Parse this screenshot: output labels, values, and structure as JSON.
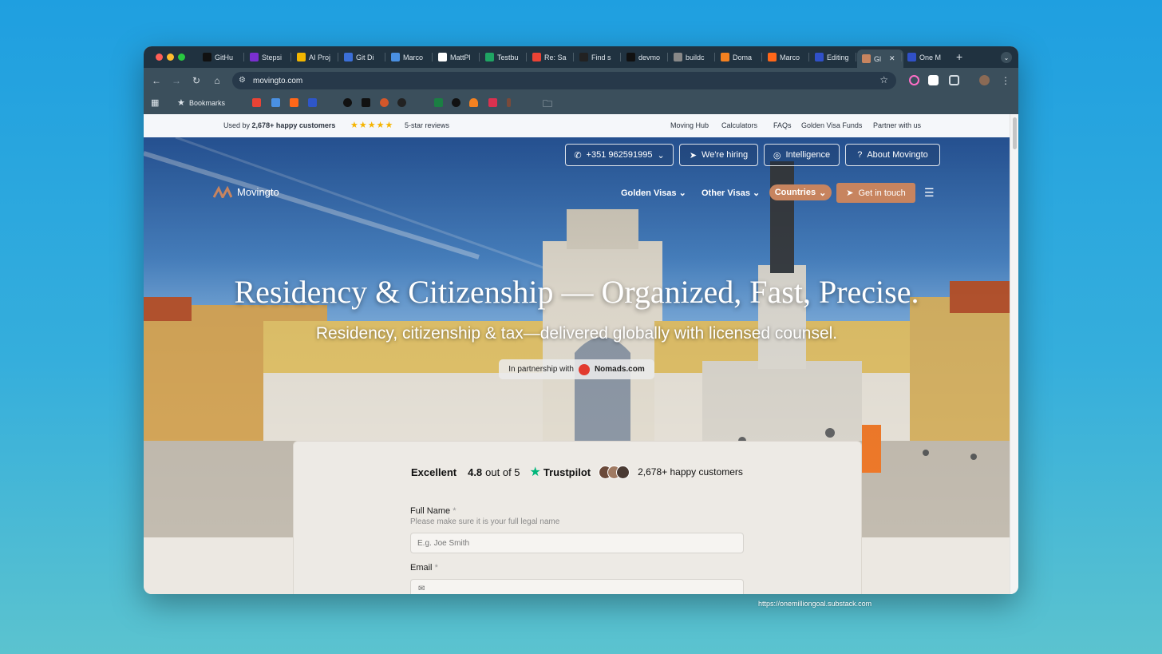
{
  "browser": {
    "tabs": [
      {
        "label": "GitHu",
        "favicon": "dev-icon",
        "color": "#111111"
      },
      {
        "label": "Stepsi",
        "favicon": "stepsize-icon",
        "color": "#7a2fd0"
      },
      {
        "label": "AI Proj",
        "favicon": "ai-icon",
        "color": "#f2b600"
      },
      {
        "label": "Git Di",
        "favicon": "git-icon",
        "color": "#3b6fd8"
      },
      {
        "label": "Marco",
        "favicon": "doc-icon",
        "color": "#4a90e2"
      },
      {
        "label": "MattPl",
        "favicon": "google-icon",
        "color": "#ffffff"
      },
      {
        "label": "Testbu",
        "favicon": "sheets-icon",
        "color": "#1fa463"
      },
      {
        "label": "Re: Sa",
        "favicon": "gmail-icon",
        "color": "#ea4335"
      },
      {
        "label": "Find s",
        "favicon": "circle-icon",
        "color": "#222222"
      },
      {
        "label": "devmo",
        "favicon": "bolt-icon",
        "color": "#111111"
      },
      {
        "label": "buildc",
        "favicon": "globe-icon",
        "color": "#888888"
      },
      {
        "label": "Doma",
        "favicon": "cloudflare-icon",
        "color": "#f48120"
      },
      {
        "label": "Marco",
        "favicon": "substack-icon",
        "color": "#ff6719"
      },
      {
        "label": "Editing",
        "favicon": "doc-icon",
        "color": "#3050c8"
      },
      {
        "label": "Gl",
        "favicon": "movingto-icon",
        "color": "#c7845f",
        "active": true
      },
      {
        "label": "One M",
        "favicon": "doc-icon",
        "color": "#3050c8"
      }
    ],
    "url": "movingto.com",
    "bookmarks_label": "Bookmarks",
    "status_url": "https://onemilliongoal.substack.com"
  },
  "topbar": {
    "used_by": "Used by",
    "used_by_strong": "2,678+ happy customers",
    "stars": "★★★★★",
    "reviews": "5-star reviews",
    "links": [
      "Moving Hub",
      "Calculators",
      "FAQs",
      "Golden Visa Funds",
      "Partner with us"
    ]
  },
  "hero": {
    "pills": {
      "phone": "+351 962591995",
      "hiring": "We're hiring",
      "intelligence": "Intelligence",
      "about": "About Movingto"
    },
    "logo_text": "Movingto",
    "nav": {
      "golden_visas": "Golden Visas",
      "other_visas": "Other Visas",
      "countries": "Countries",
      "get_in_touch": "Get in touch"
    },
    "title": "Residency & Citizenship — Organized, Fast, Precise.",
    "subtitle": "Residency, citizenship & tax—delivered globally with licensed counsel.",
    "partner_prefix": "In partnership with",
    "partner_name": "Nomads.com"
  },
  "form": {
    "rating_word": "Excellent",
    "rating_value": "4.8",
    "rating_suffix": "out of 5",
    "trustpilot": "Trustpilot",
    "customers": "2,678+ happy customers",
    "full_name_label": "Full Name",
    "full_name_hint": "Please make sure it is your full legal name",
    "full_name_placeholder": "E.g. Joe Smith",
    "email_label": "Email",
    "required_mark": "*"
  },
  "colors": {
    "accent": "#c7845f",
    "trustpilot_green": "#00b67a",
    "star_yellow": "#f5b400"
  }
}
